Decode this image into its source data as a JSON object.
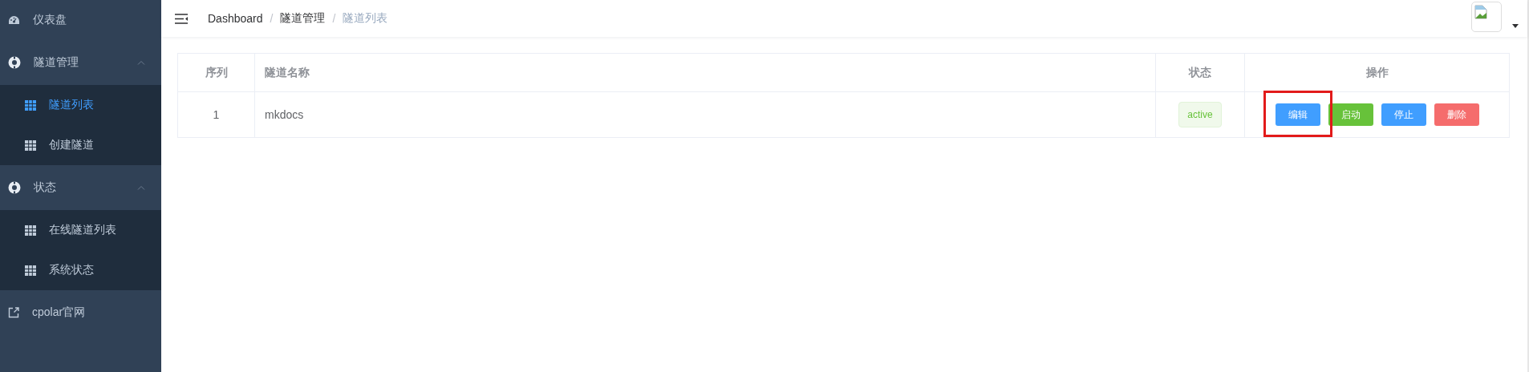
{
  "sidebar": {
    "items": [
      {
        "label": "仪表盘",
        "kind": "page",
        "selected": false
      },
      {
        "label": "隧道管理",
        "kind": "group",
        "selected": false,
        "expanded": true,
        "children": [
          {
            "label": "隧道列表",
            "selected": true
          },
          {
            "label": "创建隧道",
            "selected": false
          }
        ]
      },
      {
        "label": "状态",
        "kind": "group",
        "selected": false,
        "expanded": true,
        "children": [
          {
            "label": "在线隧道列表",
            "selected": false
          },
          {
            "label": "系统状态",
            "selected": false
          }
        ]
      },
      {
        "label": "cpolar官网",
        "kind": "external",
        "selected": false
      }
    ]
  },
  "header": {
    "breadcrumb": [
      {
        "label": "Dashboard",
        "current": false
      },
      {
        "label": "隧道管理",
        "current": false
      },
      {
        "label": "隧道列表",
        "current": true
      }
    ],
    "separator": "/"
  },
  "table": {
    "columns": [
      "序列",
      "隧道名称",
      "状态",
      "操作"
    ],
    "rows": [
      {
        "index": "1",
        "name": "mkdocs",
        "status": {
          "label": "active",
          "kind": "success"
        },
        "actions": [
          {
            "label": "编辑",
            "kind": "primary",
            "highlighted": true
          },
          {
            "label": "启动",
            "kind": "success",
            "highlighted": false
          },
          {
            "label": "停止",
            "kind": "primary",
            "highlighted": false
          },
          {
            "label": "删除",
            "kind": "danger",
            "highlighted": false
          }
        ]
      }
    ]
  }
}
